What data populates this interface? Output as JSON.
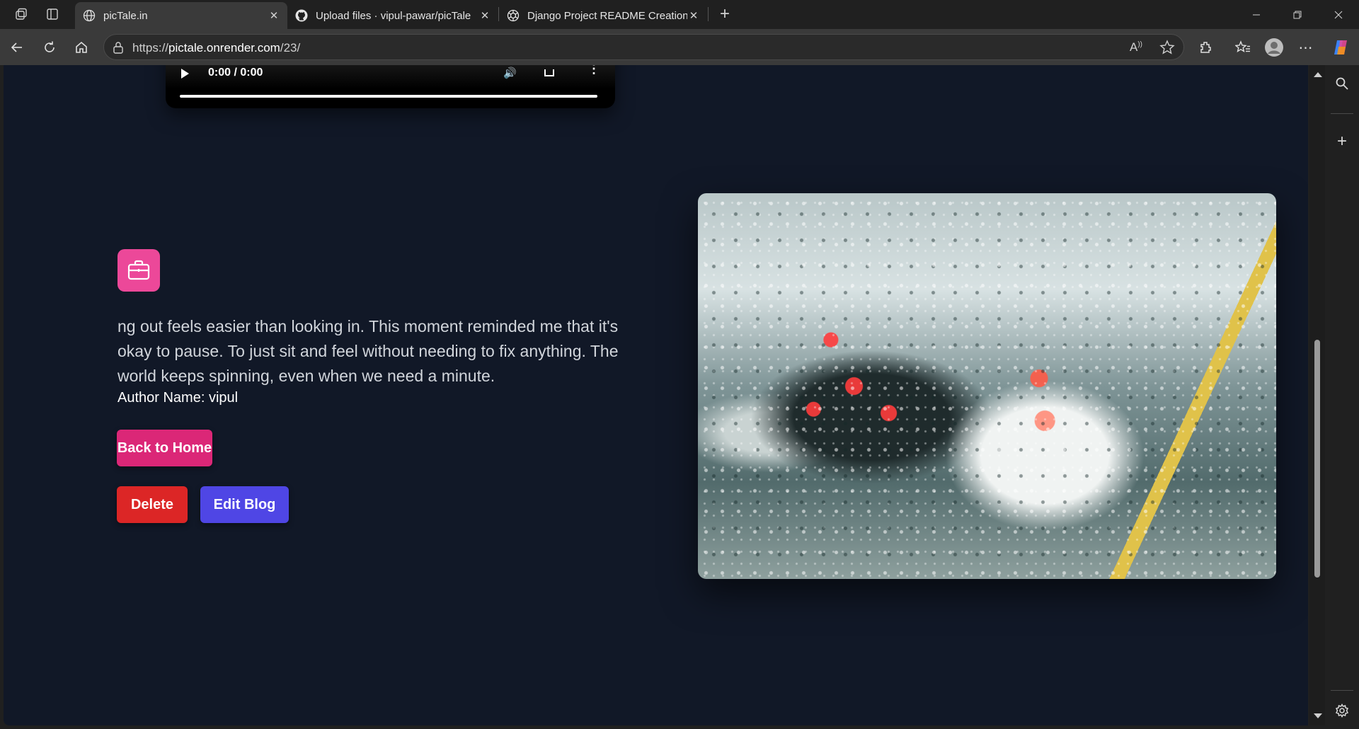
{
  "browser": {
    "tabs": [
      {
        "title": "picTale.in",
        "icon": "globe-icon",
        "active": true
      },
      {
        "title": "Upload files · vipul-pawar/picTale",
        "icon": "github-icon",
        "active": false
      },
      {
        "title": "Django Project README Creation",
        "icon": "openai-icon",
        "active": false
      }
    ],
    "url_prefix": "https://",
    "url_host": "pictale.onrender.com",
    "url_path": "/23/"
  },
  "video": {
    "time": "0:00 / 0:00"
  },
  "post": {
    "story": "ng out feels easier than looking in. This moment reminded me that it's okay to pause. To just sit and feel without needing to fix anything. The world keeps spinning, even when we need a minute.",
    "author_label": "Author Name: ",
    "author_name": "vipul",
    "back_label": "Back to Home",
    "delete_label": "Delete",
    "edit_label": "Edit Blog"
  },
  "colors": {
    "page_bg": "#111827",
    "accent_pink": "#ec4899",
    "delete_red": "#dc2626",
    "edit_indigo": "#4f46e5"
  }
}
